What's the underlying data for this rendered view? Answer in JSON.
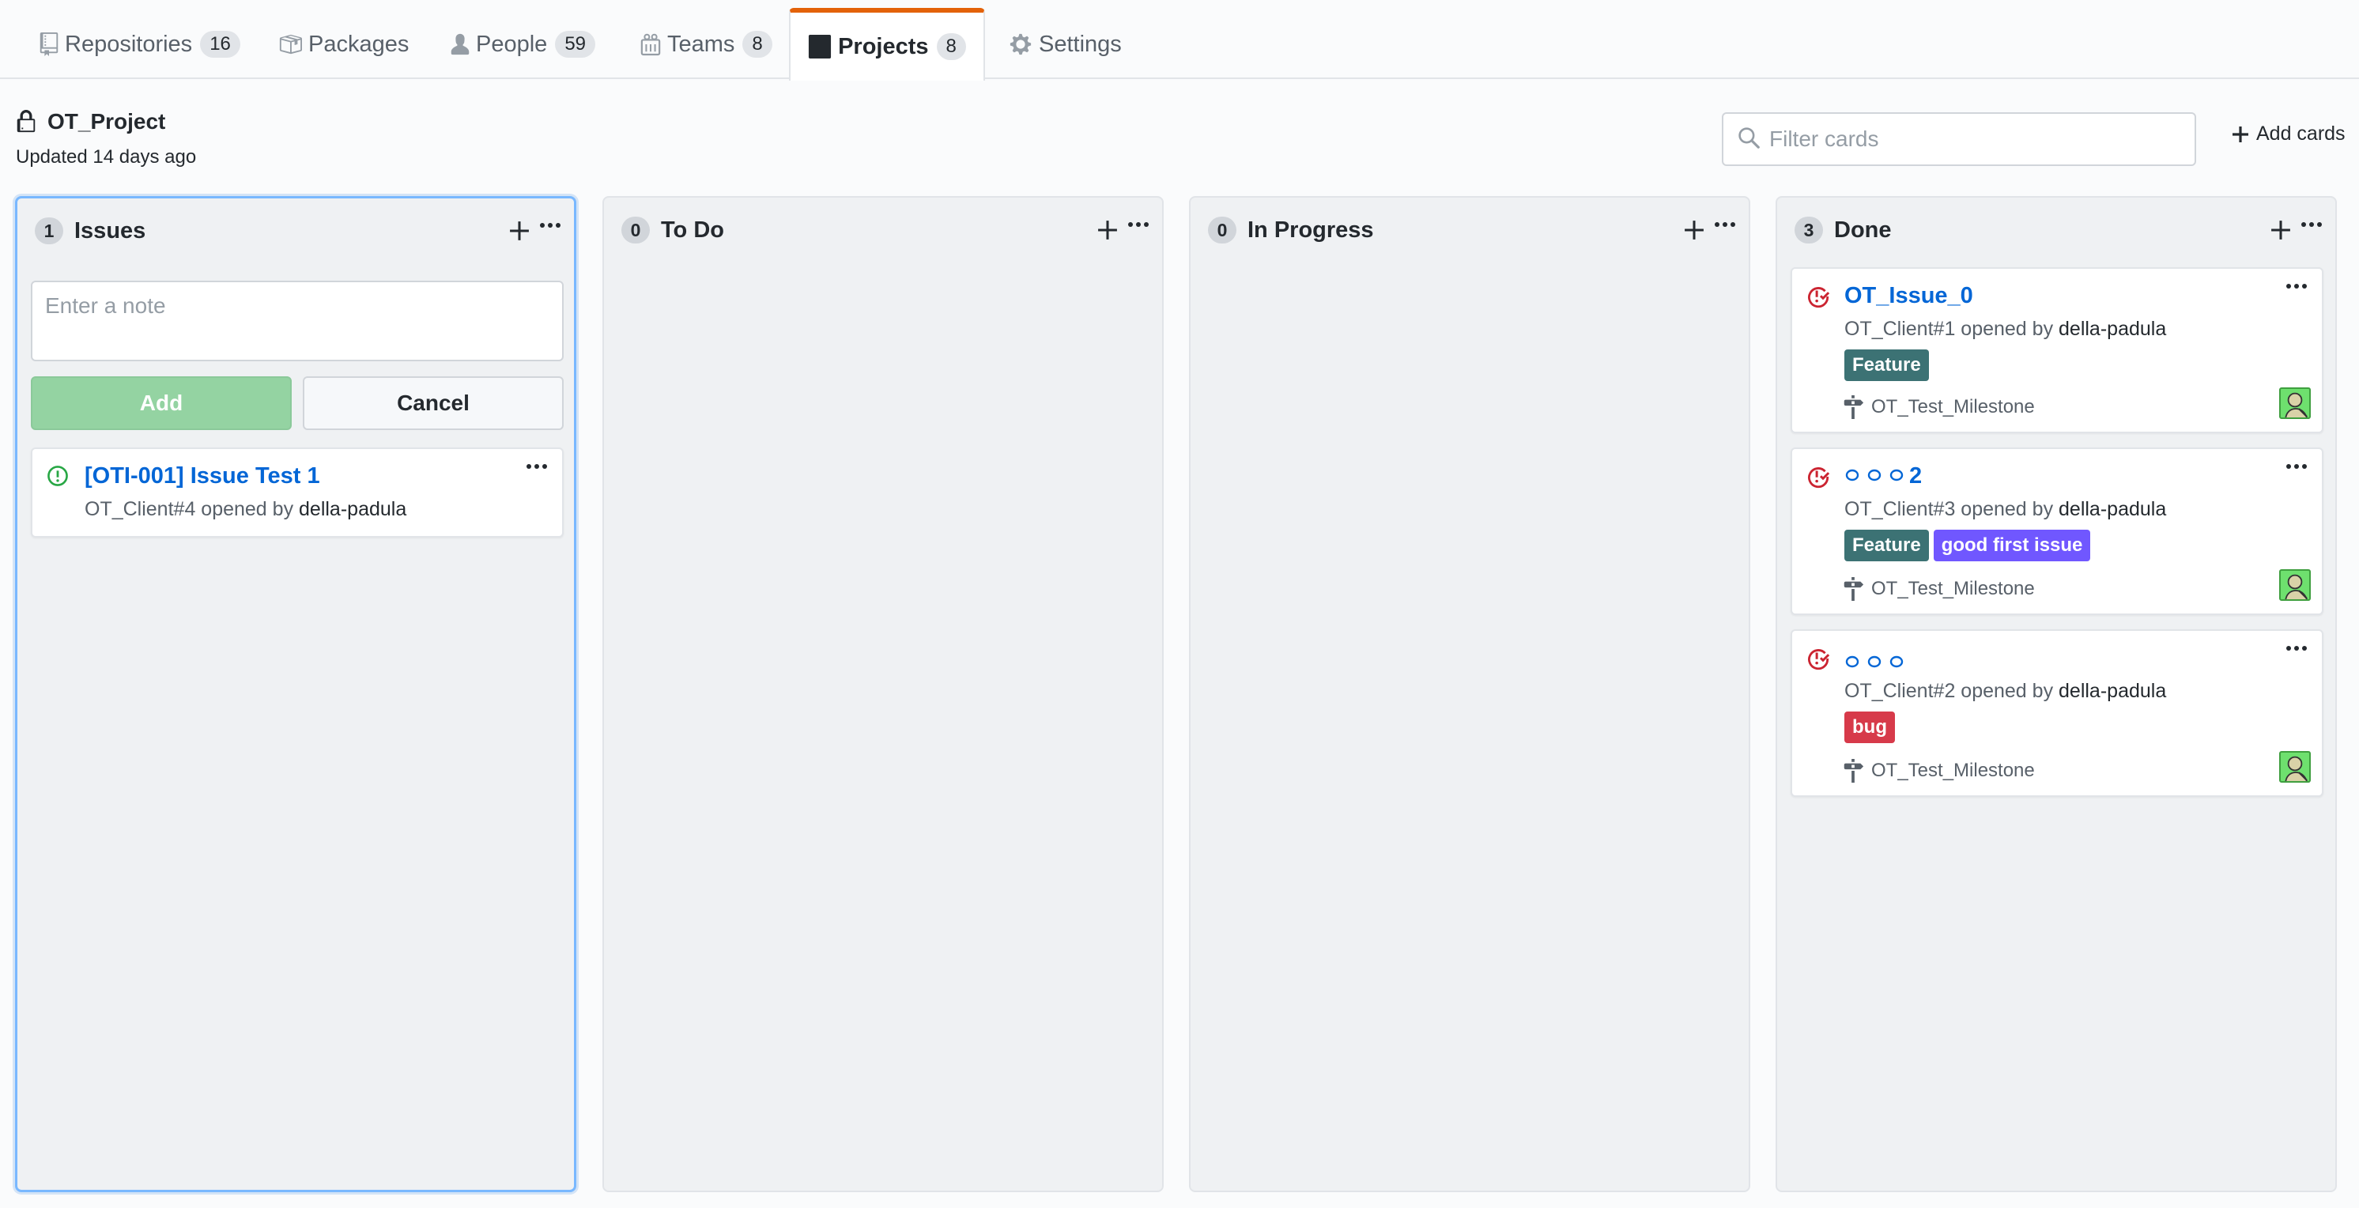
{
  "nav": {
    "tabs": [
      {
        "label": "Repositories",
        "count": "16",
        "icon": "repo-icon"
      },
      {
        "label": "Packages",
        "count": "",
        "icon": "package-icon"
      },
      {
        "label": "People",
        "count": "59",
        "icon": "person-icon"
      },
      {
        "label": "Teams",
        "count": "8",
        "icon": "people-icon"
      },
      {
        "label": "Projects",
        "count": "8",
        "icon": "project-icon",
        "selected": true
      },
      {
        "label": "Settings",
        "count": "",
        "icon": "gear-icon"
      }
    ]
  },
  "project": {
    "title": "OT_Project",
    "updated": "Updated 14 days ago",
    "filter_placeholder": "Filter cards",
    "add_cards_label": "Add cards"
  },
  "columns": [
    {
      "name": "Issues",
      "count": "1",
      "note_form": {
        "placeholder": "Enter a note",
        "add_label": "Add",
        "cancel_label": "Cancel"
      },
      "cards": [
        {
          "title": "[OTI-001] Issue Test 1",
          "ref": "OT_Client#4 opened by ",
          "author": "della-padula",
          "state": "open"
        }
      ]
    },
    {
      "name": "To Do",
      "count": "0",
      "cards": []
    },
    {
      "name": "In Progress",
      "count": "0",
      "cards": []
    },
    {
      "name": "Done",
      "count": "3",
      "cards": [
        {
          "title": "OT_Issue_0",
          "ref": "OT_Client#1 opened by ",
          "author": "della-padula",
          "state": "closed",
          "labels": [
            {
              "name": "Feature",
              "color": "#3c7274"
            }
          ],
          "milestone": "OT_Test_Milestone"
        },
        {
          "title": "2",
          "ref": "OT_Client#3 opened by ",
          "author": "della-padula",
          "state": "closed",
          "labels": [
            {
              "name": "Feature",
              "color": "#3c7274"
            },
            {
              "name": "good first issue",
              "color": "#7057ff"
            }
          ],
          "milestone": "OT_Test_Milestone"
        },
        {
          "title": "",
          "ref": "OT_Client#2 opened by ",
          "author": "della-padula",
          "state": "closed",
          "labels": [
            {
              "name": "bug",
              "color": "#d73a4a"
            }
          ],
          "milestone": "OT_Test_Milestone"
        }
      ]
    }
  ],
  "colors": {
    "accent": "#e36209",
    "link": "#0366d6",
    "open_state": "#28a745",
    "closed_state": "#cb2431",
    "focus_border": "#79b8ff"
  }
}
